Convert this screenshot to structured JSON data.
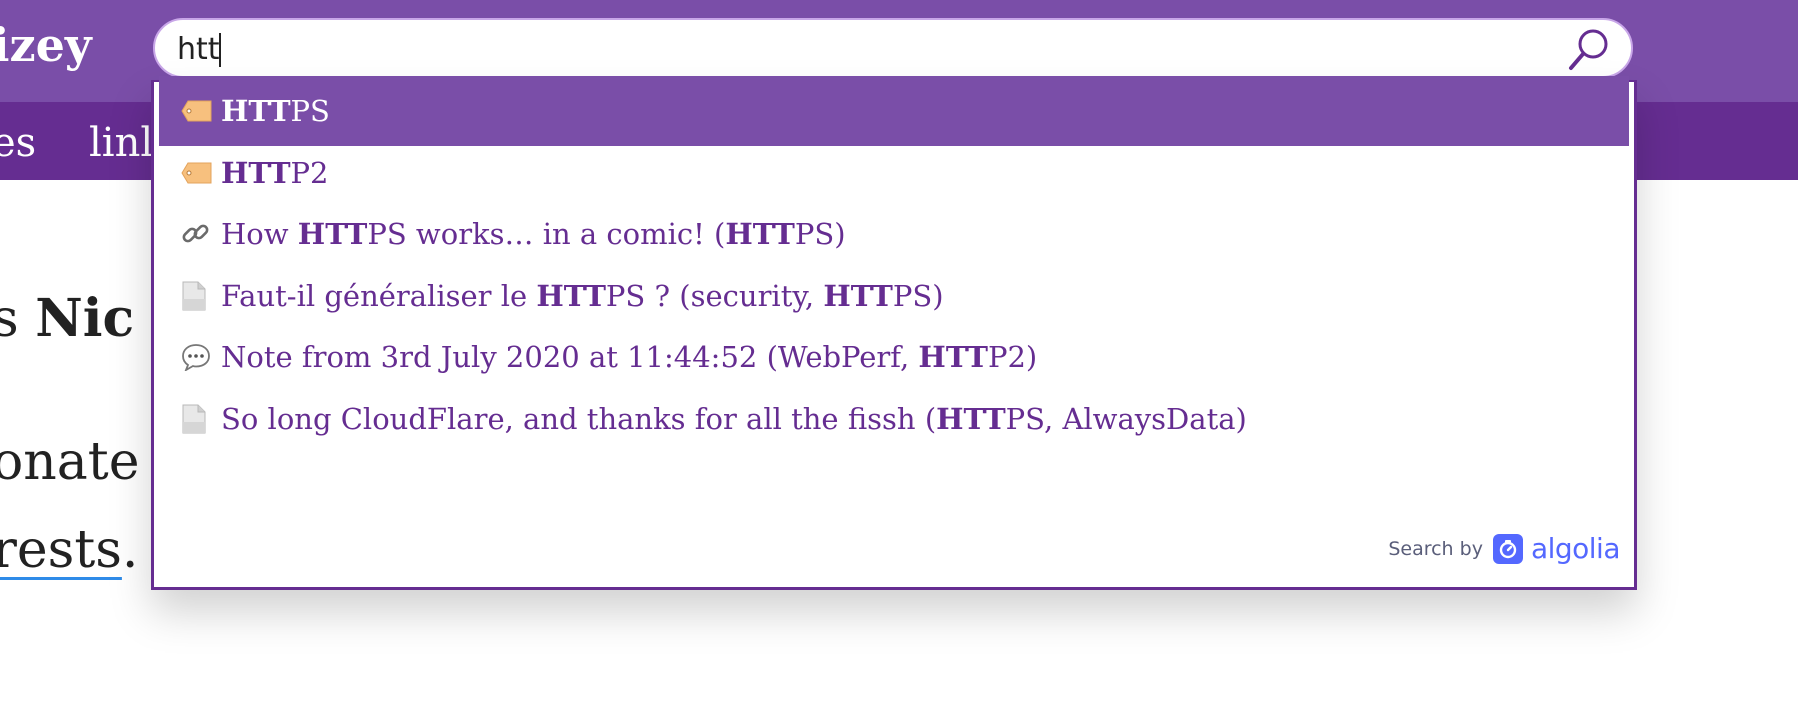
{
  "header": {
    "brand": "izey",
    "nav": [
      "es",
      "linl"
    ]
  },
  "page": {
    "line1_prefix": "s ",
    "line1_bold": "Nic",
    "line2": "onate",
    "line3_link": "rests",
    "line3_suffix": "."
  },
  "search": {
    "value": "htt"
  },
  "suggestions": [
    {
      "icon": "tag-icon",
      "parts": [
        {
          "b": "HTT"
        },
        {
          "t": "PS"
        }
      ]
    },
    {
      "icon": "tag-icon",
      "parts": [
        {
          "b": "HTT"
        },
        {
          "t": "P2"
        }
      ]
    },
    {
      "icon": "link-icon",
      "parts": [
        {
          "t": "How "
        },
        {
          "b": "HTT"
        },
        {
          "t": "PS works… in a comic! ("
        },
        {
          "b": "HTT"
        },
        {
          "t": "PS)"
        }
      ]
    },
    {
      "icon": "document-icon",
      "parts": [
        {
          "t": "Faut-il généraliser le "
        },
        {
          "b": "HTT"
        },
        {
          "t": "PS ? (security, "
        },
        {
          "b": "HTT"
        },
        {
          "t": "PS)"
        }
      ]
    },
    {
      "icon": "speech-bubble-icon",
      "parts": [
        {
          "t": "Note from 3rd July 2020 at 11:44:52 (WebPerf, "
        },
        {
          "b": "HTT"
        },
        {
          "t": "P2)"
        }
      ]
    },
    {
      "icon": "document-icon",
      "parts": [
        {
          "t": "So long CloudFlare, and thanks for all the fissh ("
        },
        {
          "b": "HTT"
        },
        {
          "t": "PS, AlwaysData)"
        }
      ]
    }
  ],
  "footer": {
    "search_by": "Search by",
    "provider": "algolia"
  },
  "colors": {
    "header": "#7a4ea8",
    "nav": "#652d91",
    "accent": "#652d91",
    "algolia": "#5468ff"
  }
}
